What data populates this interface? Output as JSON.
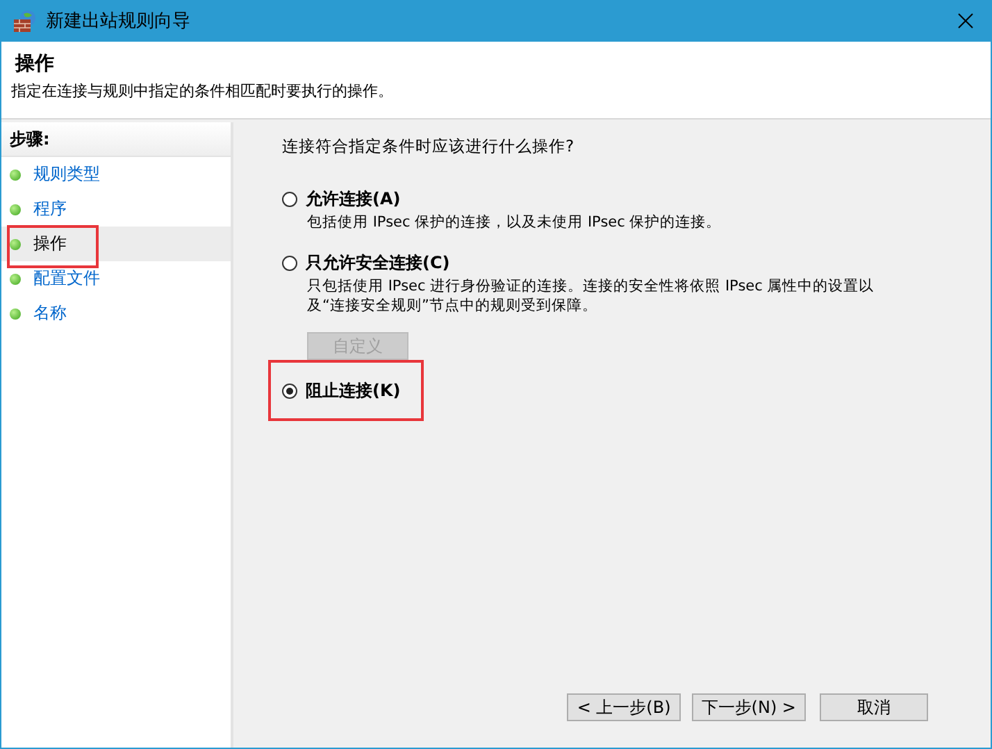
{
  "window": {
    "title": "新建出站规则向导"
  },
  "header": {
    "title": "操作",
    "description": "指定在连接与规则中指定的条件相匹配时要执行的操作。"
  },
  "steps": {
    "heading": "步骤:",
    "items": [
      {
        "label": "规则类型",
        "selected": false,
        "highlighted": false
      },
      {
        "label": "程序",
        "selected": false,
        "highlighted": false
      },
      {
        "label": "操作",
        "selected": true,
        "highlighted": true
      },
      {
        "label": "配置文件",
        "selected": false,
        "highlighted": false
      },
      {
        "label": "名称",
        "selected": false,
        "highlighted": false
      }
    ]
  },
  "question": "连接符合指定条件时应该进行什么操作?",
  "options": [
    {
      "label": "允许连接(A)",
      "description": "包括使用 IPsec 保护的连接，以及未使用 IPsec 保护的连接。",
      "selected": false,
      "highlighted": false
    },
    {
      "label": "只允许安全连接(C)",
      "description": "只包括使用 IPsec 进行身份验证的连接。连接的安全性将依照 IPsec 属性中的设置以及“连接安全规则”节点中的规则受到保障。",
      "selected": false,
      "highlighted": false,
      "button": {
        "label": "自定义",
        "disabled": true
      }
    },
    {
      "label": "阻止连接(K)",
      "selected": true,
      "highlighted": true
    }
  ],
  "buttons": [
    {
      "label": "< 上一步(B)"
    },
    {
      "label": "下一步(N) >"
    },
    {
      "label": "取消"
    }
  ]
}
